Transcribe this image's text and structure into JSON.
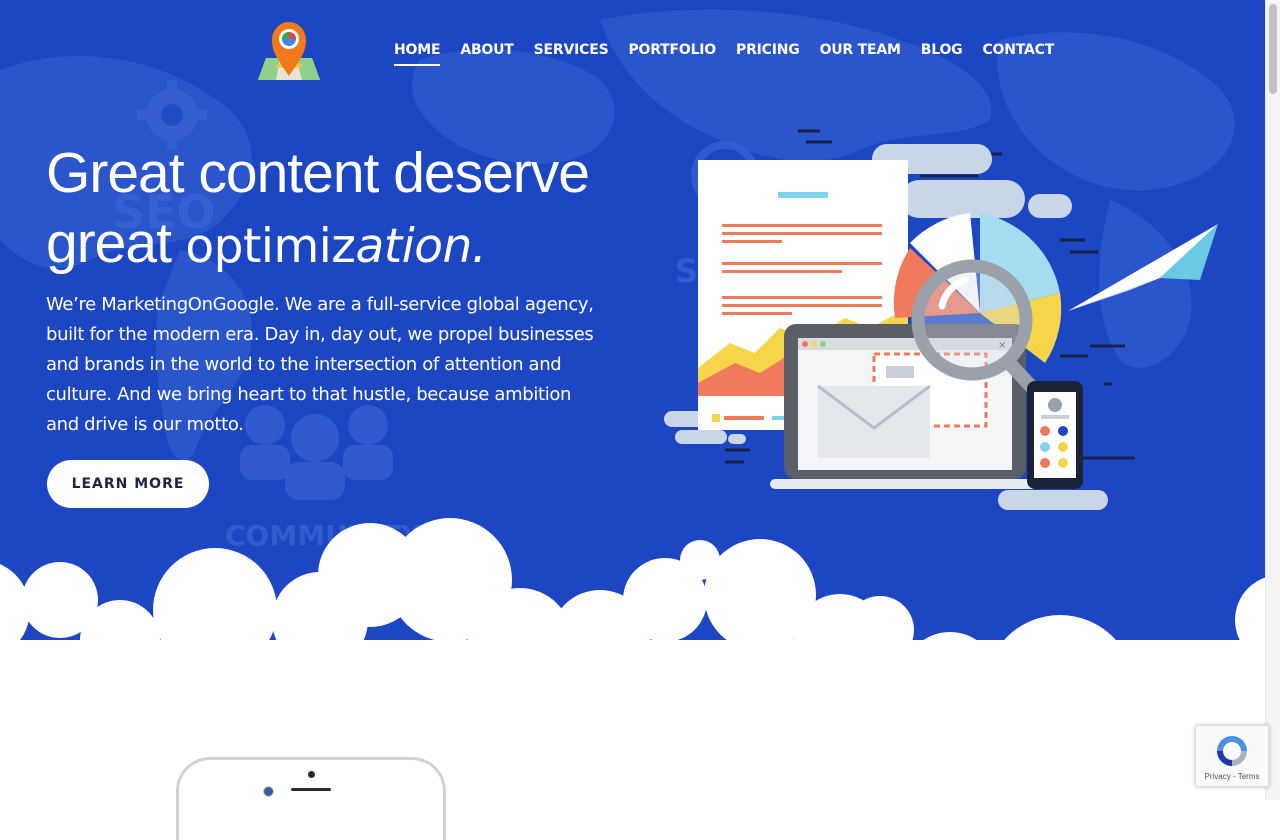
{
  "brand": {
    "name": "MarketingOnGoogle"
  },
  "nav": {
    "items": [
      {
        "label": "HOME",
        "active": true
      },
      {
        "label": "ABOUT"
      },
      {
        "label": "SERVICES"
      },
      {
        "label": "PORTFOLIO"
      },
      {
        "label": "PRICING"
      },
      {
        "label": "OUR TEAM"
      },
      {
        "label": "BLOG"
      },
      {
        "label": "CONTACT"
      }
    ]
  },
  "hero": {
    "headline_line1": "Great content deserve",
    "headline_word": "great",
    "headline_em_a": "optimiz",
    "headline_em_b": "ation.",
    "intro": "We’re MarketingOnGoogle. We are a full-service global agency, built for the modern era. Day in, day out, we propel businesses and brands in the world to the intersection of attention and culture. And we bring heart to that hustle, because ambition and drive is our motto.",
    "cta_label": "LEARN MORE",
    "background_words": [
      "SEO",
      "SMM",
      "COMMUNITY"
    ],
    "colors": {
      "background": "#1d47c2",
      "text": "#ffffff",
      "button_bg": "#ffffff",
      "button_text": "#1d2540"
    }
  },
  "illustration": {
    "icons": [
      "document-icon",
      "pie-chart-icon",
      "magnifier-icon",
      "laptop-icon",
      "envelope-icon",
      "smartphone-icon",
      "paper-plane-icon"
    ]
  },
  "recaptcha": {
    "privacy": "Privacy",
    "separator": " - ",
    "terms": "Terms"
  }
}
